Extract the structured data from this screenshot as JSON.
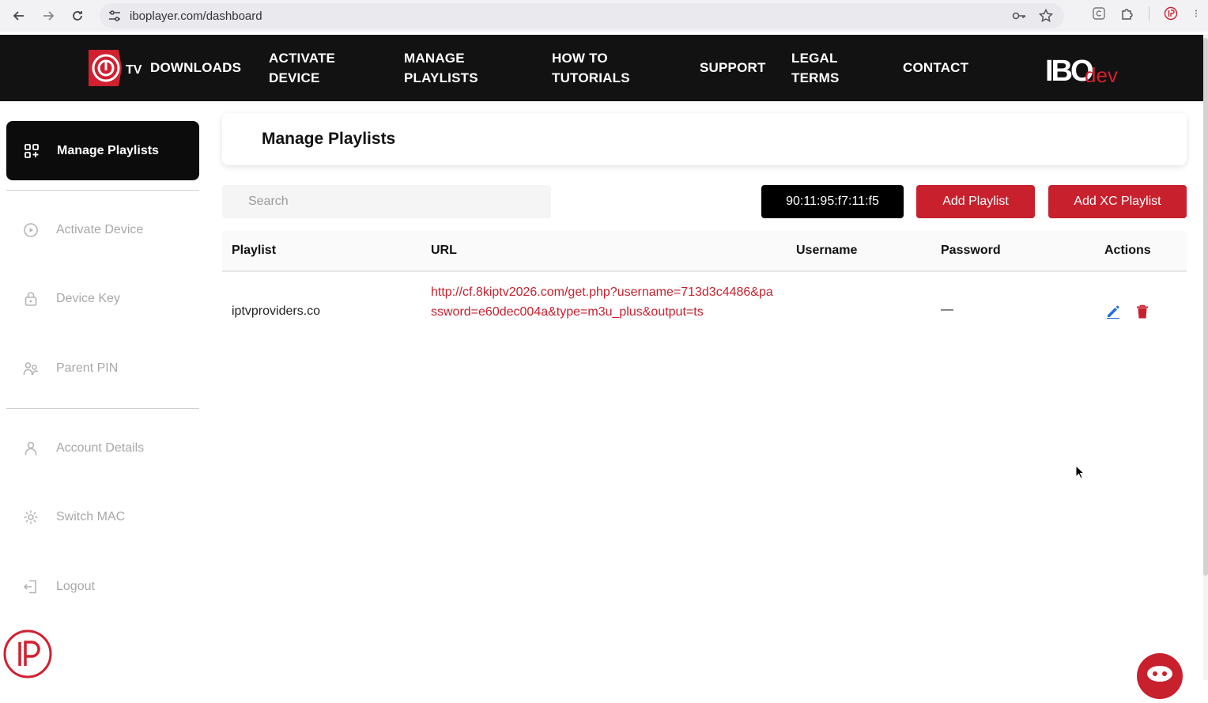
{
  "browser": {
    "url": "iboplayer.com/dashboard"
  },
  "nav": {
    "tv_label": "TV",
    "items": [
      {
        "line1": "DOWNLOADS",
        "line2": ""
      },
      {
        "line1": "ACTIVATE",
        "line2": "DEVICE"
      },
      {
        "line1": "MANAGE",
        "line2": "PLAYLISTS"
      },
      {
        "line1": "HOW TO",
        "line2": "TUTORIALS"
      },
      {
        "line1": "SUPPORT",
        "line2": ""
      },
      {
        "line1": "LEGAL",
        "line2": "TERMS"
      },
      {
        "line1": "CONTACT",
        "line2": ""
      }
    ],
    "brand_logo_text": "IBO",
    "brand_logo_suffix": "dev."
  },
  "sidebar": {
    "active": "Manage Playlists",
    "items": [
      {
        "label": "Activate Device",
        "icon": "play-circle-icon"
      },
      {
        "label": "Device Key",
        "icon": "lock-icon"
      },
      {
        "label": "Parent PIN",
        "icon": "users-icon"
      },
      {
        "label": "Account Details",
        "icon": "user-icon"
      },
      {
        "label": "Switch MAC",
        "icon": "gear-icon"
      },
      {
        "label": "Logout",
        "icon": "logout-icon"
      }
    ]
  },
  "main": {
    "title": "Manage Playlists",
    "search_placeholder": "Search",
    "mac_address": "90:11:95:f7:11:f5",
    "add_playlist": "Add Playlist",
    "add_xc_playlist": "Add XC Playlist",
    "table": {
      "headers": [
        "Playlist",
        "URL",
        "Username",
        "Password",
        "Actions"
      ],
      "rows": [
        {
          "playlist": "iptvproviders.co",
          "url": "http://cf.8kiptv2026.com/get.php?username=713d3c4486&password=e60dec004a&type=m3u_plus&output=ts",
          "username": "",
          "password": "—"
        }
      ]
    }
  },
  "colors": {
    "accent": "#c8202d",
    "nav_bg": "#121212",
    "edit_icon": "#1f6fe0"
  }
}
